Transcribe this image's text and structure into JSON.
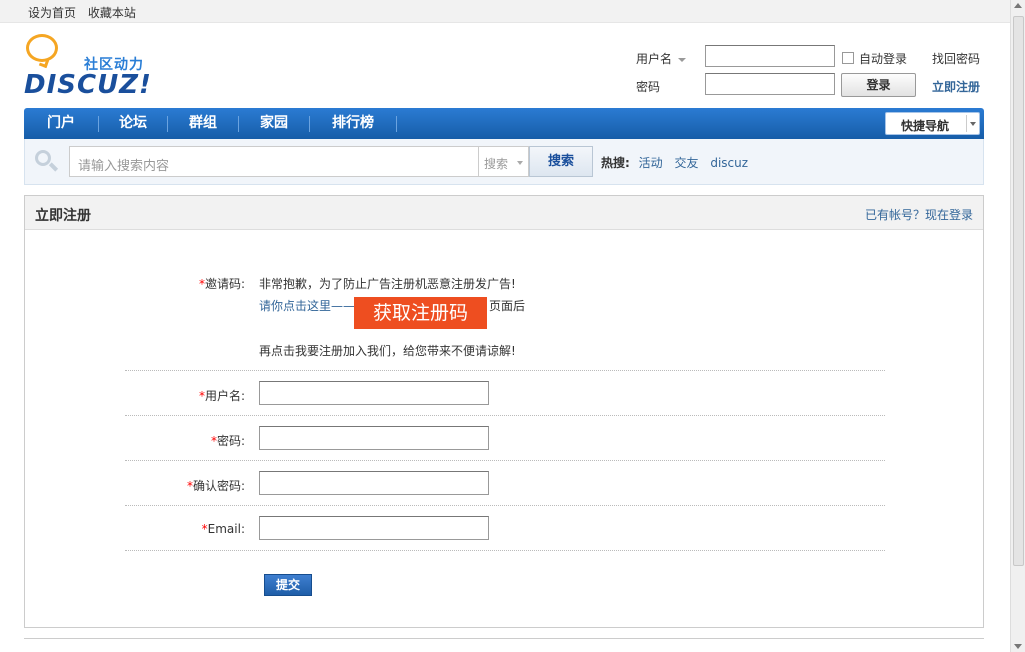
{
  "topbar": {
    "set_home": "设为首页",
    "bookmark": "收藏本站"
  },
  "logo": {
    "subtitle": "社区动力",
    "name": "DISCUZ!"
  },
  "login": {
    "username_label": "用户名",
    "password_label": "密码",
    "username_value": "",
    "password_value": "",
    "auto_login_label": "自动登录",
    "login_button": "登录",
    "find_password": "找回密码",
    "register_now": "立即注册"
  },
  "nav": {
    "items": [
      {
        "label": "门户"
      },
      {
        "label": "论坛"
      },
      {
        "label": "群组"
      },
      {
        "label": "家园"
      },
      {
        "label": "排行榜"
      }
    ],
    "quick_nav": "快捷导航"
  },
  "search": {
    "placeholder": "请输入搜索内容",
    "type_label": "搜索",
    "button": "搜索",
    "hot_label": "热搜:",
    "hot_terms": [
      "活动",
      "交友",
      "discuz"
    ]
  },
  "register": {
    "title": "立即注册",
    "have_account": "已有帐号？现在登录",
    "invite": {
      "required_mark": "*",
      "label": "邀请码:",
      "line1": "非常抱歉，为了防止广告注册机恶意注册发广告!",
      "click_here": "请你点击这里——",
      "get_code": "获取注册码",
      "after": "页面后",
      "line3": "再点击我要注册加入我们，给您带来不便请谅解!"
    },
    "fields": [
      {
        "required_mark": "*",
        "label": "用户名:",
        "value": ""
      },
      {
        "required_mark": "*",
        "label": "密码:",
        "value": ""
      },
      {
        "required_mark": "*",
        "label": "确认密码:",
        "value": ""
      },
      {
        "required_mark": "*",
        "label": "Email:",
        "value": ""
      }
    ],
    "submit": "提交"
  }
}
